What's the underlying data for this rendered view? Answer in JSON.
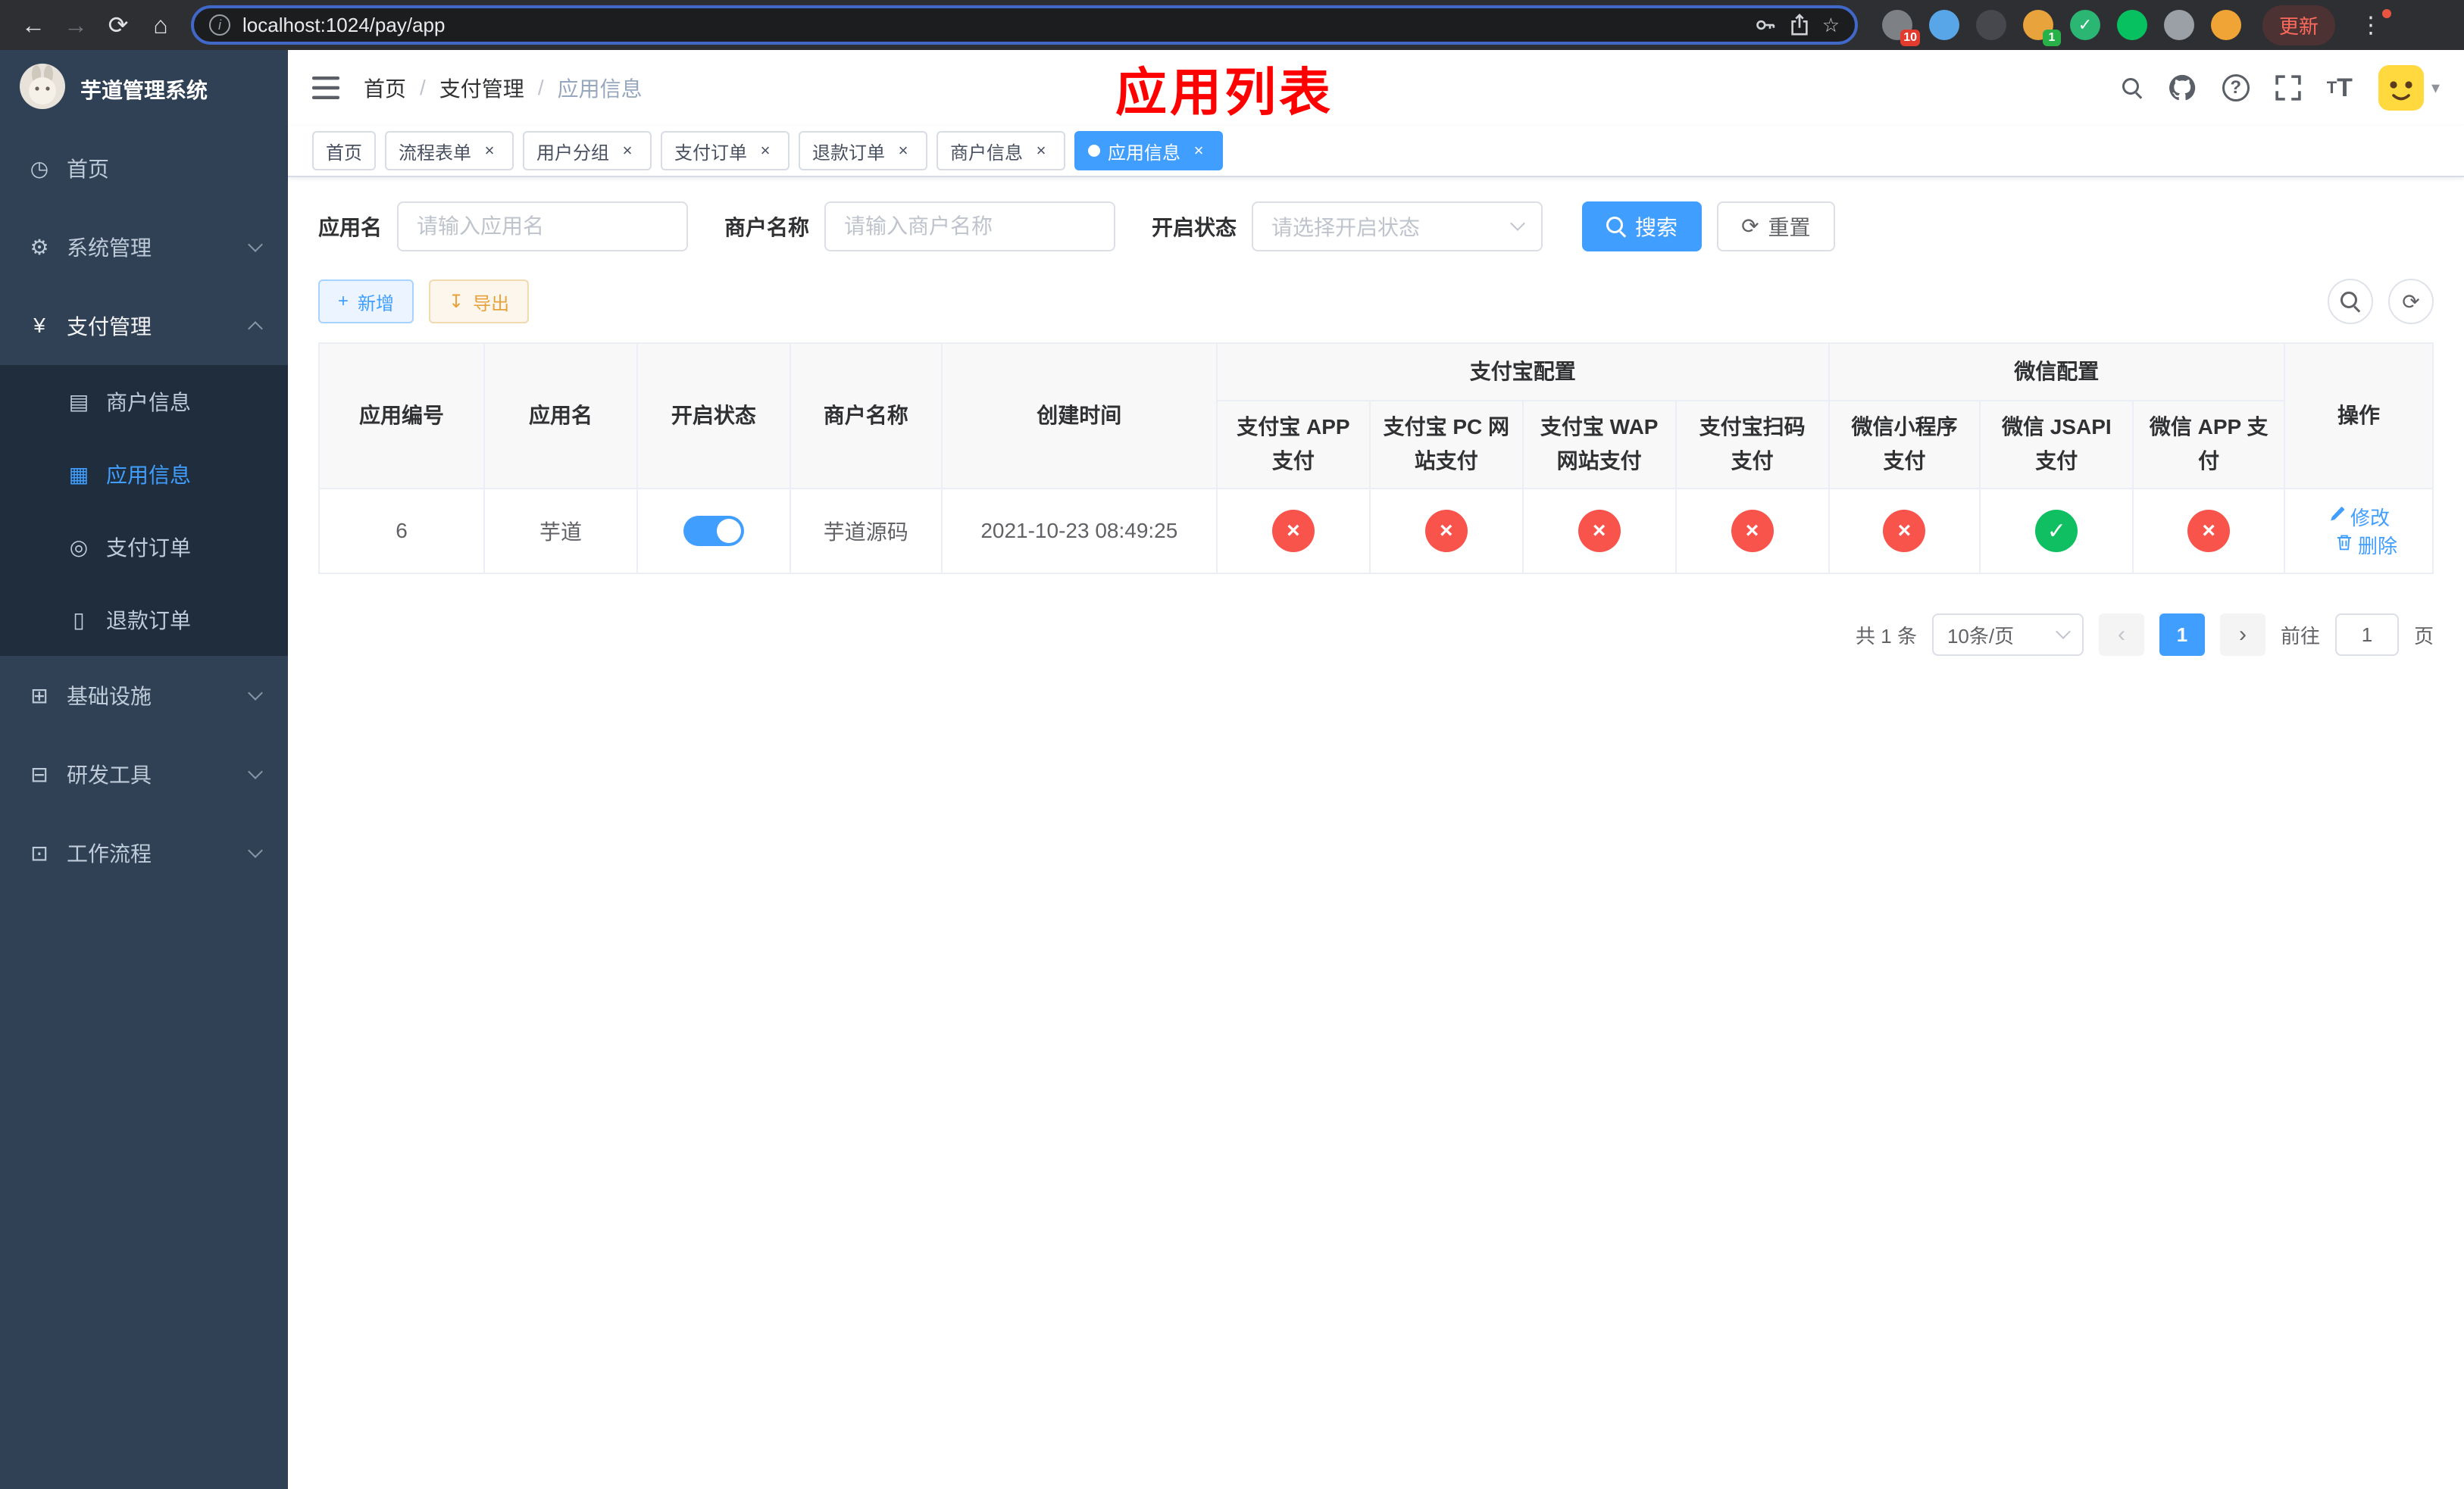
{
  "browser": {
    "url": "localhost:1024/pay/app",
    "update_label": "更新",
    "extensions": [
      {
        "key": "grid",
        "name": "ext-grid-icon",
        "color": "#7d8186",
        "badge": "10",
        "badge_color": "#e33b2e"
      },
      {
        "key": "drop",
        "name": "ext-drop-icon",
        "color": "#58a6e8"
      },
      {
        "key": "dark",
        "name": "ext-dark-icon",
        "color": "#46484d"
      },
      {
        "key": "leaf",
        "name": "ext-leaf-icon",
        "color": "#e8a33d",
        "badge": "1",
        "badge_color": "#27b148"
      },
      {
        "key": "check",
        "name": "ext-check-icon",
        "color": "#2bb673",
        "glyph": "✓"
      },
      {
        "key": "chat",
        "name": "ext-chat-icon",
        "color": "#07c160"
      },
      {
        "key": "puzzle",
        "name": "ext-puzzle-icon",
        "color": "#9aa0a6"
      },
      {
        "key": "face",
        "name": "ext-face-icon",
        "color": "#f0a435"
      }
    ]
  },
  "sidebar": {
    "title": "芋道管理系统",
    "items": [
      {
        "key": "home",
        "label": "首页",
        "icon": "dashboard-icon"
      },
      {
        "key": "system",
        "label": "系统管理",
        "icon": "gear-icon",
        "expandable": true
      },
      {
        "key": "payment",
        "label": "支付管理",
        "icon": "yen-icon",
        "expandable": true,
        "expanded": true,
        "children": [
          {
            "key": "merchant-info",
            "label": "商户信息",
            "icon": "card-icon"
          },
          {
            "key": "app-info",
            "label": "应用信息",
            "icon": "grid-icon",
            "active": true
          },
          {
            "key": "pay-order",
            "label": "支付订单",
            "icon": "target-icon"
          },
          {
            "key": "refund-order",
            "label": "退款订单",
            "icon": "doc-icon"
          }
        ]
      },
      {
        "key": "infra",
        "label": "基础设施",
        "icon": "infra-icon",
        "expandable": true
      },
      {
        "key": "devtools",
        "label": "研发工具",
        "icon": "tools-icon",
        "expandable": true
      },
      {
        "key": "workflow",
        "label": "工作流程",
        "icon": "flow-icon",
        "expandable": true
      }
    ]
  },
  "header": {
    "breadcrumb": [
      "首页",
      "支付管理",
      "应用信息"
    ],
    "page_title": "应用列表"
  },
  "tabs": [
    {
      "key": "home",
      "label": "首页",
      "closable": false
    },
    {
      "key": "process-form",
      "label": "流程表单",
      "closable": true
    },
    {
      "key": "user-group",
      "label": "用户分组",
      "closable": true
    },
    {
      "key": "pay-order",
      "label": "支付订单",
      "closable": true
    },
    {
      "key": "refund-order",
      "label": "退款订单",
      "closable": true
    },
    {
      "key": "merchant-info",
      "label": "商户信息",
      "closable": true
    },
    {
      "key": "app-info",
      "label": "应用信息",
      "closable": true,
      "active": true
    }
  ],
  "filters": {
    "app_name_label": "应用名",
    "app_name_placeholder": "请输入应用名",
    "merchant_label": "商户名称",
    "merchant_placeholder": "请输入商户名称",
    "status_label": "开启状态",
    "status_placeholder": "请选择开启状态",
    "search_label": "搜索",
    "reset_label": "重置"
  },
  "toolbar": {
    "add_label": "新增",
    "export_label": "导出"
  },
  "table": {
    "simple_columns_left": [
      "应用编号",
      "应用名",
      "开启状态",
      "商户名称",
      "创建时间"
    ],
    "groups": [
      {
        "label": "支付宝配置",
        "children": [
          "支付宝 APP 支付",
          "支付宝 PC 网站支付",
          "支付宝 WAP 网站支付",
          "支付宝扫码支付"
        ]
      },
      {
        "label": "微信配置",
        "children": [
          "微信小程序支付",
          "微信 JSAPI 支付",
          "微信 APP 支付"
        ]
      }
    ],
    "simple_columns_right": [
      "操作"
    ],
    "status_keys": [
      "alipay-app-pay",
      "alipay-pc-pay",
      "alipay-wap-pay",
      "alipay-qr-pay",
      "wechat-mini-pay",
      "wechat-jsapi-pay",
      "wechat-app-pay"
    ],
    "rows": [
      {
        "app_id": "6",
        "app_name": "芋道",
        "enabled": true,
        "merchant_name": "芋道源码",
        "create_time": "2021-10-23 08:49:25",
        "statuses": [
          false,
          false,
          false,
          false,
          false,
          true,
          false
        ],
        "edit_label": "修改",
        "delete_label": "删除"
      }
    ]
  },
  "pagination": {
    "total_label": "共 1 条",
    "page_size": "10条/页",
    "current_page": "1",
    "goto_label": "前往",
    "goto_value": "1",
    "page_suffix": "页"
  },
  "colors": {
    "accent": "#409eff",
    "danger_circle": "#f9544b",
    "success_circle": "#0fbf61",
    "sidebar_bg": "#304156",
    "submenu_bg": "#1f2d3d",
    "annotation_red": "#ff0000",
    "warning": "#e6a23c"
  }
}
